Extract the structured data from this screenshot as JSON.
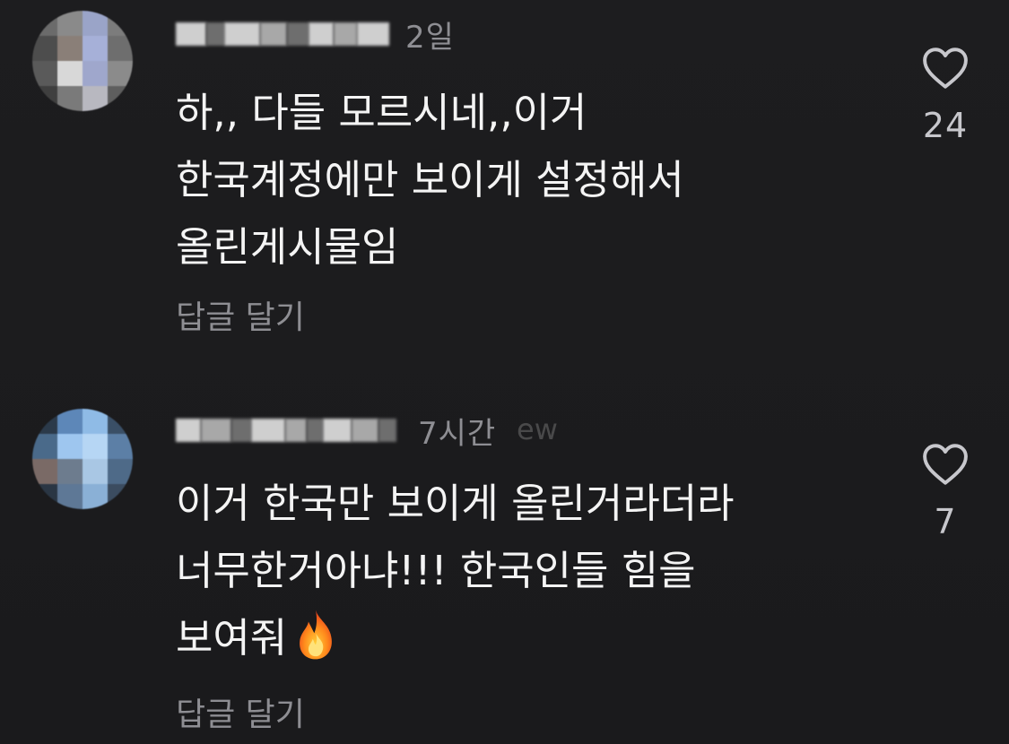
{
  "comments": [
    {
      "timestamp": "2일",
      "text_lines": [
        "하,, 다들 모르시네,,이거",
        "한국계정에만 보이게 설정해서",
        "올린게시물임"
      ],
      "reply_label": "답글 달기",
      "like_count": "24",
      "like_icon": "heart-outline-icon"
    },
    {
      "timestamp": "7시간",
      "watermark": "ew",
      "text_lines": [
        "이거 한국만 보이게 올린거라더라",
        "너무한거아냐!!! 한국인들 힘을",
        "보여줘"
      ],
      "emoji_icon": "fire-emoji-icon",
      "reply_label": "답글 달기",
      "like_count": "7",
      "like_icon": "heart-outline-icon"
    }
  ],
  "colors": {
    "background": "#1c1c1e",
    "text_primary": "#f4f4f4",
    "text_secondary": "#8e8e93"
  }
}
